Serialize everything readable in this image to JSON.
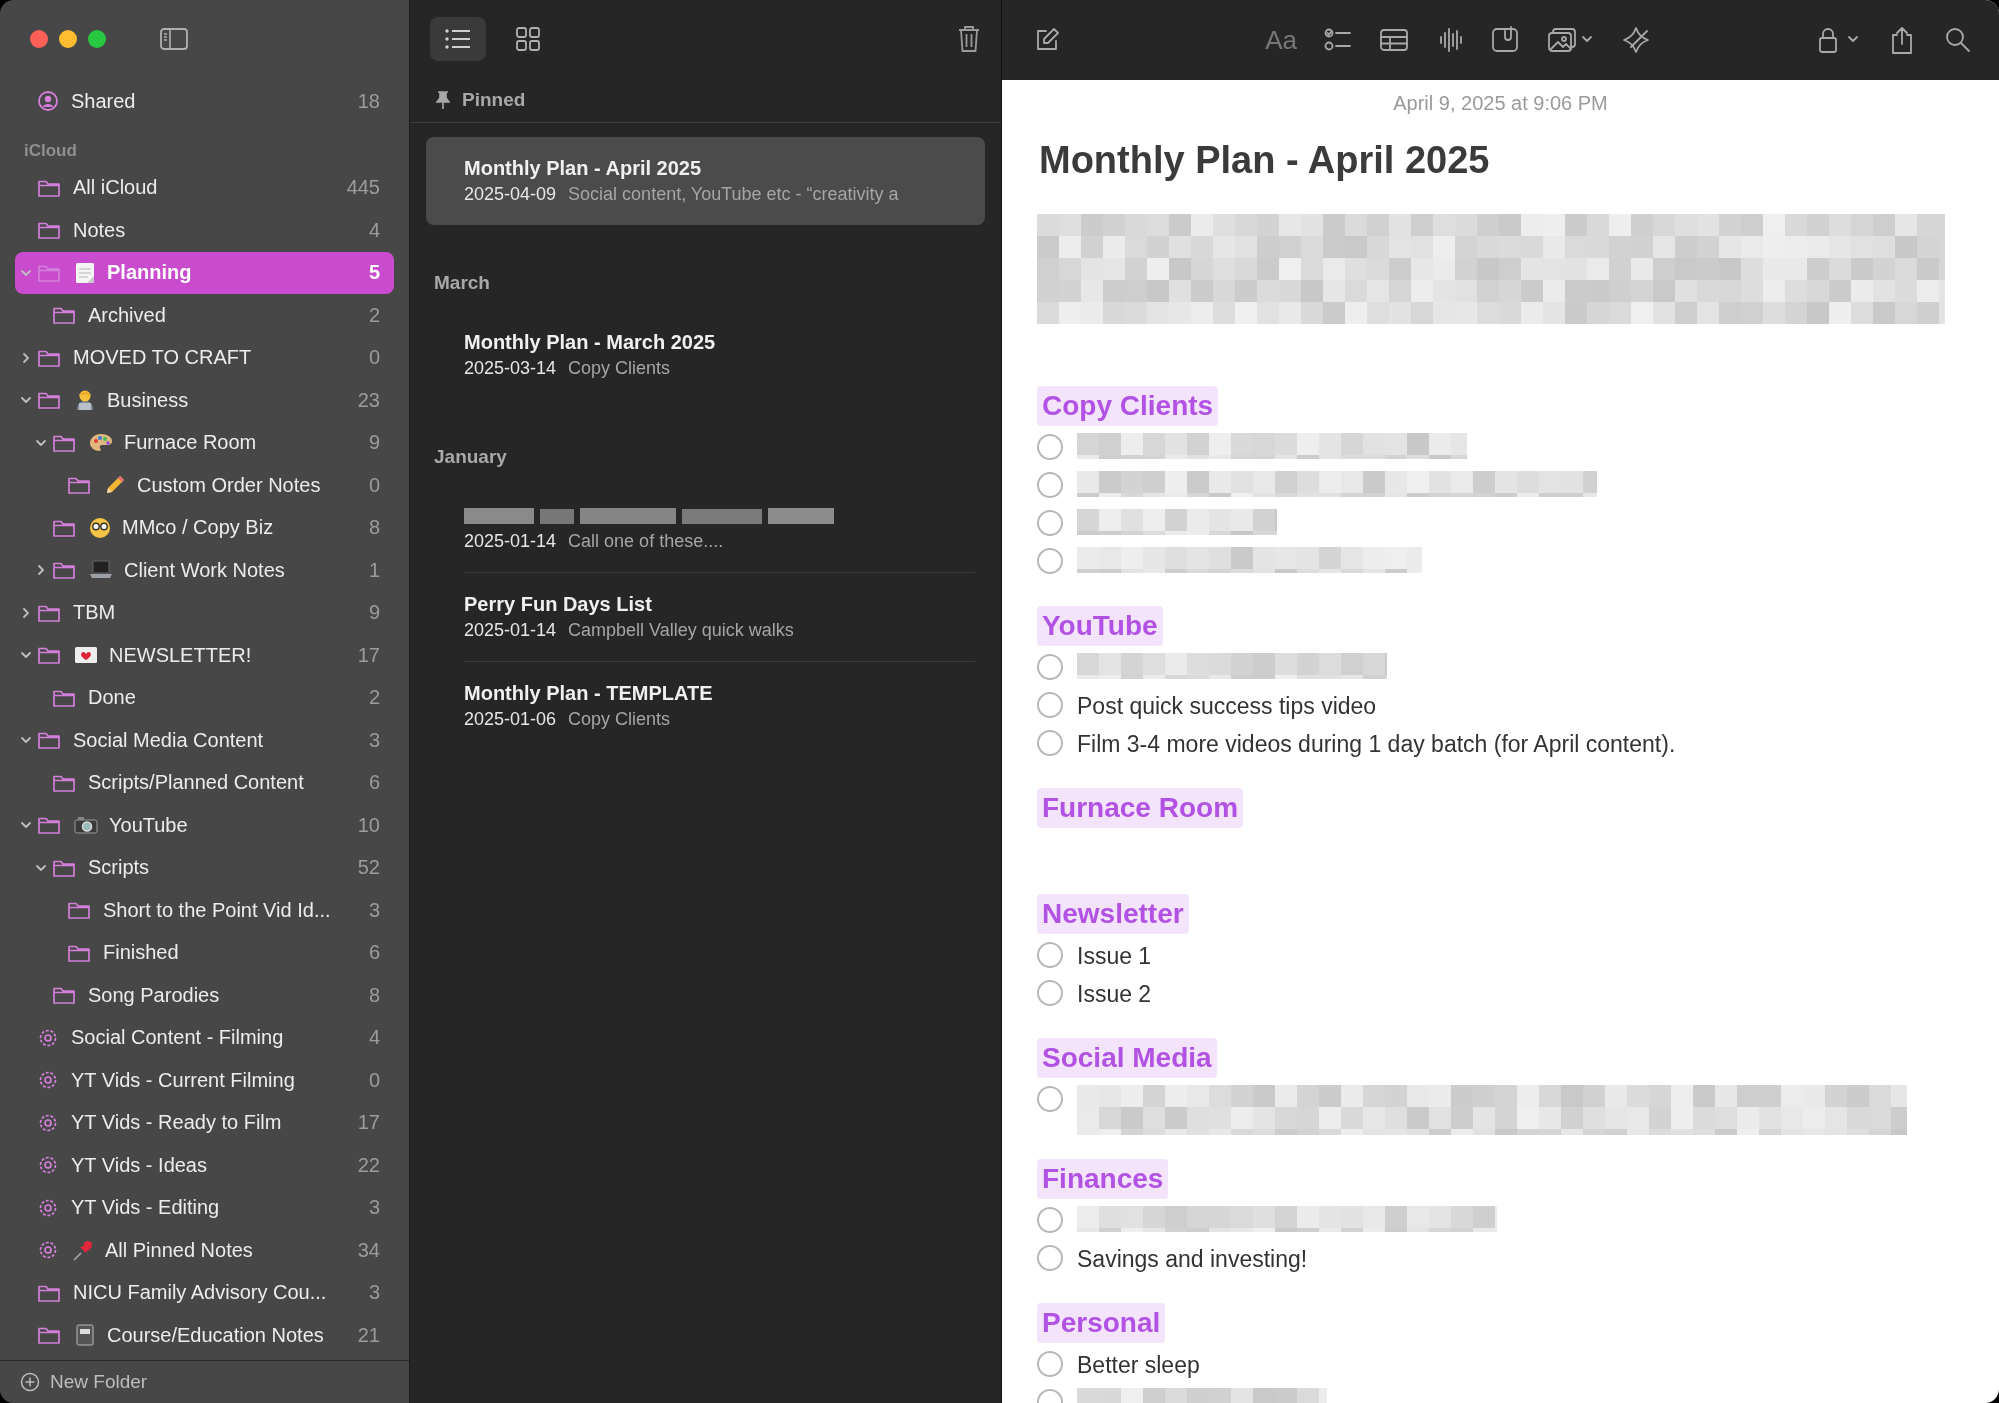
{
  "sidebar": {
    "shared": {
      "label": "Shared",
      "count": "18",
      "selected": false
    },
    "section": "iCloud",
    "folders": [
      {
        "label": "All iCloud",
        "count": "445",
        "kind": "folder",
        "selected": false
      },
      {
        "label": "Notes",
        "count": "4",
        "kind": "folder",
        "selected": false
      },
      {
        "label": "Planning",
        "count": "5",
        "kind": "notepad",
        "expanded": true,
        "selected": true,
        "children": [
          {
            "label": "Archived",
            "count": "2",
            "kind": "folder",
            "selected": false
          }
        ]
      },
      {
        "label": "MOVED TO CRAFT",
        "count": "0",
        "kind": "folder",
        "expanded": false,
        "selected": false
      },
      {
        "label": "Business",
        "count": "23",
        "kind": "worker",
        "expanded": true,
        "selected": false,
        "children": [
          {
            "label": "Furnace Room",
            "count": "9",
            "kind": "palette",
            "expanded": true,
            "selected": false,
            "children": [
              {
                "label": "Custom Order Notes",
                "count": "0",
                "kind": "pencil",
                "selected": false
              }
            ]
          },
          {
            "label": "MMco / Copy Biz",
            "count": "8",
            "kind": "glasses",
            "selected": false
          },
          {
            "label": "Client Work Notes",
            "count": "1",
            "kind": "laptop",
            "expanded": false,
            "selected": false
          }
        ]
      },
      {
        "label": "TBM",
        "count": "9",
        "kind": "folder",
        "expanded": false,
        "selected": false
      },
      {
        "label": "NEWSLETTER!",
        "count": "17",
        "kind": "envelope",
        "expanded": true,
        "selected": false,
        "children": [
          {
            "label": "Done",
            "count": "2",
            "kind": "folder",
            "selected": false
          }
        ]
      },
      {
        "label": "Social Media Content",
        "count": "3",
        "kind": "folder",
        "expanded": true,
        "selected": false,
        "children": [
          {
            "label": "Scripts/Planned Content",
            "count": "6",
            "kind": "folder",
            "selected": false
          }
        ]
      },
      {
        "label": "YouTube",
        "count": "10",
        "kind": "camera",
        "expanded": true,
        "selected": false,
        "children": [
          {
            "label": "Scripts",
            "count": "52",
            "kind": "folder",
            "expanded": true,
            "selected": false,
            "children": [
              {
                "label": "Short to the Point Vid Id...",
                "count": "3",
                "kind": "folder",
                "selected": false
              },
              {
                "label": "Finished",
                "count": "6",
                "kind": "folder",
                "selected": false
              }
            ]
          },
          {
            "label": "Song Parodies",
            "count": "8",
            "kind": "folder",
            "selected": false
          }
        ]
      },
      {
        "label": "Social Content - Filming",
        "count": "4",
        "kind": "smart",
        "selected": false
      },
      {
        "label": "YT Vids - Current Filming",
        "count": "0",
        "kind": "smart",
        "selected": false
      },
      {
        "label": "YT Vids - Ready to Film",
        "count": "17",
        "kind": "smart",
        "selected": false
      },
      {
        "label": "YT Vids - Ideas",
        "count": "22",
        "kind": "smart",
        "selected": false
      },
      {
        "label": "YT Vids - Editing",
        "count": "3",
        "kind": "smart",
        "selected": false
      },
      {
        "label": "All Pinned Notes",
        "count": "34",
        "kind": "pin",
        "selected": false
      },
      {
        "label": "NICU Family Advisory Cou...",
        "count": "3",
        "kind": "folder",
        "selected": false
      },
      {
        "label": "Course/Education Notes",
        "count": "21",
        "kind": "notebook",
        "selected": false
      }
    ],
    "new_folder": "New Folder"
  },
  "note_list": {
    "view": [
      {
        "kind": "list",
        "selected": true
      },
      {
        "kind": "grid",
        "selected": false
      }
    ],
    "groups": [
      {
        "title": "Pinned",
        "kind": "pinned",
        "notes": [
          {
            "title": "Monthly Plan - April 2025",
            "date": "2025-04-09",
            "snippet": "Social content, YouTube etc - “creativity a",
            "selected": true
          }
        ]
      },
      {
        "title": "March",
        "kind": "month",
        "notes": [
          {
            "title": "Monthly Plan - March 2025",
            "date": "2025-03-14",
            "snippet": "Copy Clients",
            "selected": false
          }
        ]
      },
      {
        "title": "January",
        "kind": "month",
        "notes": [
          {
            "title_blurred": true,
            "date": "2025-01-14",
            "snippet": "Call one of these....",
            "selected": false
          },
          {
            "title": "Perry Fun Days List",
            "date": "2025-01-14",
            "snippet": "Campbell Valley quick walks",
            "selected": false
          },
          {
            "title": "Monthly Plan - TEMPLATE",
            "date": "2025-01-06",
            "snippet": "Copy Clients",
            "selected": false
          }
        ]
      }
    ]
  },
  "editor": {
    "format_label": "Aa",
    "date": "April 9, 2025 at 9:06 PM",
    "title": "Monthly Plan - April 2025",
    "intro": {
      "kind": "redacted"
    },
    "sections": [
      {
        "heading": "Copy Clients",
        "items": [
          {
            "kind": "redacted",
            "checked": false
          },
          {
            "kind": "redacted",
            "checked": false
          },
          {
            "kind": "redacted",
            "checked": false
          },
          {
            "kind": "redacted",
            "checked": false
          }
        ]
      },
      {
        "heading": "YouTube",
        "items": [
          {
            "kind": "redacted",
            "checked": false
          },
          {
            "kind": "task",
            "text": "Post quick success tips video",
            "checked": false
          },
          {
            "kind": "task",
            "text": "Film 3-4 more videos during 1 day batch (for April content).",
            "checked": false
          }
        ]
      },
      {
        "heading": "Furnace Room"
      },
      {
        "heading": "Newsletter",
        "items": [
          {
            "kind": "task",
            "text": "Issue 1",
            "checked": false
          },
          {
            "kind": "task",
            "text": "Issue 2",
            "checked": false
          }
        ]
      },
      {
        "heading": "Social Media",
        "items": [
          {
            "kind": "redacted2",
            "checked": false
          }
        ]
      },
      {
        "heading": "Finances",
        "items": [
          {
            "kind": "redacted",
            "checked": false
          },
          {
            "kind": "task",
            "text": "Savings and investing!",
            "checked": false
          }
        ]
      },
      {
        "heading": "Personal",
        "items": [
          {
            "kind": "task",
            "text": "Better sleep",
            "checked": false
          },
          {
            "kind": "redacted",
            "checked": false
          }
        ]
      }
    ]
  }
}
